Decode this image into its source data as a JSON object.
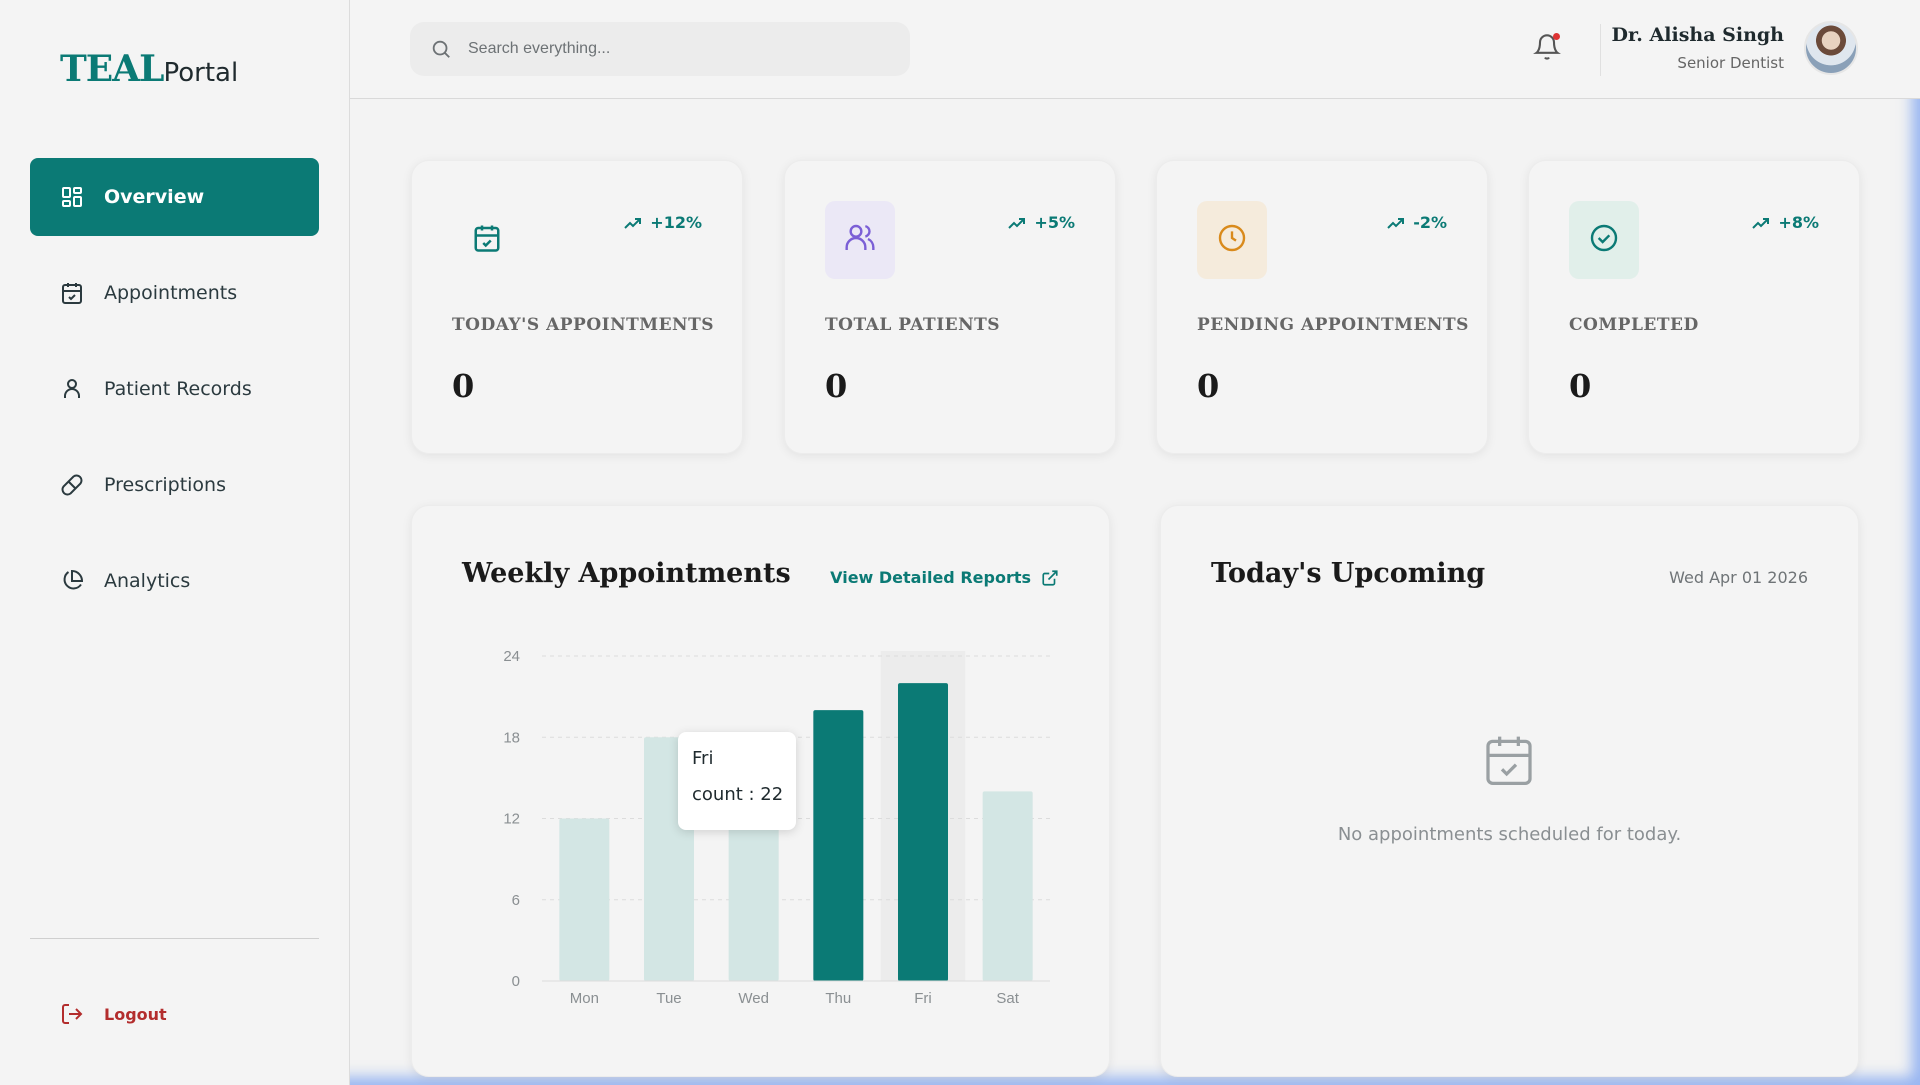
{
  "brand": {
    "name": "TEAL",
    "suffix": "Portal"
  },
  "sidebar": {
    "items": [
      {
        "label": "Overview",
        "icon": "grid-icon",
        "active": true
      },
      {
        "label": "Appointments",
        "icon": "calendar-icon"
      },
      {
        "label": "Patient Records",
        "icon": "user-icon"
      },
      {
        "label": "Prescriptions",
        "icon": "pill-icon"
      },
      {
        "label": "Analytics",
        "icon": "pie-chart-icon"
      }
    ],
    "logout_label": "Logout"
  },
  "header": {
    "search_placeholder": "Search everything...",
    "user_name": "Dr. Alisha Singh",
    "user_role": "Senior Dentist"
  },
  "stats": [
    {
      "label": "TODAY'S APPOINTMENTS",
      "value": "0",
      "trend": "+12%",
      "icon": "calendar-check-icon",
      "icon_color": "#0b7a75",
      "icon_bg": "#f4f4f4"
    },
    {
      "label": "TOTAL PATIENTS",
      "value": "0",
      "trend": "+5%",
      "icon": "users-icon",
      "icon_color": "#7b5fd6",
      "icon_bg": "#ebe8f6"
    },
    {
      "label": "PENDING APPOINTMENTS",
      "value": "0",
      "trend": "-2%",
      "icon": "clock-icon",
      "icon_color": "#d98a1c",
      "icon_bg": "#f5ebdc"
    },
    {
      "label": "COMPLETED",
      "value": "0",
      "trend": "+8%",
      "icon": "check-circle-icon",
      "icon_color": "#0b7a75",
      "icon_bg": "#e1efea"
    }
  ],
  "weekly": {
    "title": "Weekly Appointments",
    "link_label": "View Detailed Reports",
    "tooltip": {
      "day": "Fri",
      "text": "count : 22"
    }
  },
  "chart_data": {
    "type": "bar",
    "categories": [
      "Mon",
      "Tue",
      "Wed",
      "Thu",
      "Fri",
      "Sat"
    ],
    "values": [
      12,
      18,
      12,
      20,
      22,
      14
    ],
    "highlighted": [
      "Thu",
      "Fri"
    ],
    "hovered": "Fri",
    "ylim": [
      0,
      24
    ],
    "yticks": [
      0,
      6,
      12,
      18,
      24
    ],
    "grid": true,
    "colors": {
      "highlight": "#0b7a75",
      "normal": "#d3e6e4",
      "hover_band": "#ececec"
    }
  },
  "upcoming": {
    "title": "Today's Upcoming",
    "date": "Wed Apr 01 2026",
    "empty_text": "No appointments scheduled for today."
  }
}
